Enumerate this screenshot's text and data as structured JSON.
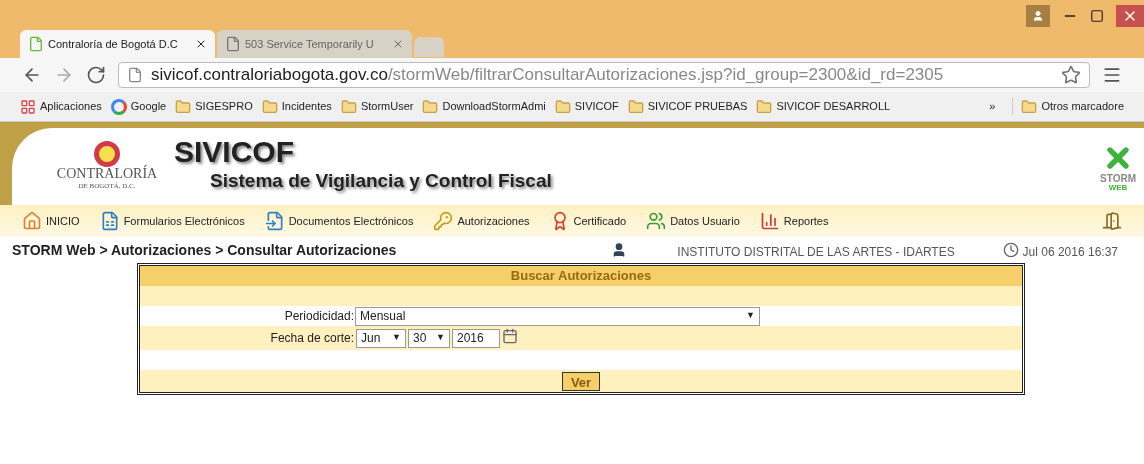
{
  "browser": {
    "tabs": [
      {
        "title": "Contraloría de Bogotá D.C",
        "selected": true
      },
      {
        "title": "503 Service Temporarily U",
        "selected": false
      }
    ],
    "address": {
      "host": "sivicof.contraloriabogota.gov.co",
      "path": "/stormWeb/filtrarConsultarAutorizaciones.jsp?id_group=2300&id_rd=2305"
    },
    "bookmarks": [
      {
        "label": "Aplicaciones",
        "kind": "apps"
      },
      {
        "label": "Google",
        "kind": "google"
      },
      {
        "label": "SIGESPRO",
        "kind": "folder"
      },
      {
        "label": "Incidentes",
        "kind": "folder"
      },
      {
        "label": "StormUser",
        "kind": "folder"
      },
      {
        "label": "DownloadStormAdmi",
        "kind": "folder"
      },
      {
        "label": "SIVICOF",
        "kind": "folder"
      },
      {
        "label": "SIVICOF PRUEBAS",
        "kind": "folder"
      },
      {
        "label": "SIVICOF DESARROLL",
        "kind": "folder"
      }
    ],
    "overflow": "»",
    "other_bookmarks": "Otros marcadore"
  },
  "header": {
    "org_name": "CONTRALORÍA",
    "org_sub": "DE BOGOTÁ, D.C.",
    "app_name": "SIVICOF",
    "app_subtitle": "Sistema de Vigilancia y Control Fiscal",
    "brand": "STORM",
    "brand_sub": "WEB"
  },
  "nav": [
    {
      "label": "INICIO",
      "kind": "home"
    },
    {
      "label": "Formularios Electrónicos",
      "kind": "forms"
    },
    {
      "label": "Documentos Electrónicos",
      "kind": "documents"
    },
    {
      "label": "Autorizaciones",
      "kind": "key"
    },
    {
      "label": "Certificado",
      "kind": "certificate"
    },
    {
      "label": "Datos Usuario",
      "kind": "users"
    },
    {
      "label": "Reportes",
      "kind": "reports"
    }
  ],
  "breadcrumb": "STORM Web > Autorizaciones > Consultar Autorizaciones",
  "entity": "INSTITUTO DISTRITAL DE LAS ARTES - IDARTES",
  "datetime": "Jul 06 2016 16:37",
  "form": {
    "title": "Buscar Autorizaciones",
    "periodicidad": {
      "label": "Periodicidad:",
      "value": "Mensual"
    },
    "fecha": {
      "label": "Fecha de corte:",
      "month": "Jun",
      "day": "30",
      "year": "2016"
    },
    "submit": "Ver",
    "dropdown_arrow": "▼"
  }
}
